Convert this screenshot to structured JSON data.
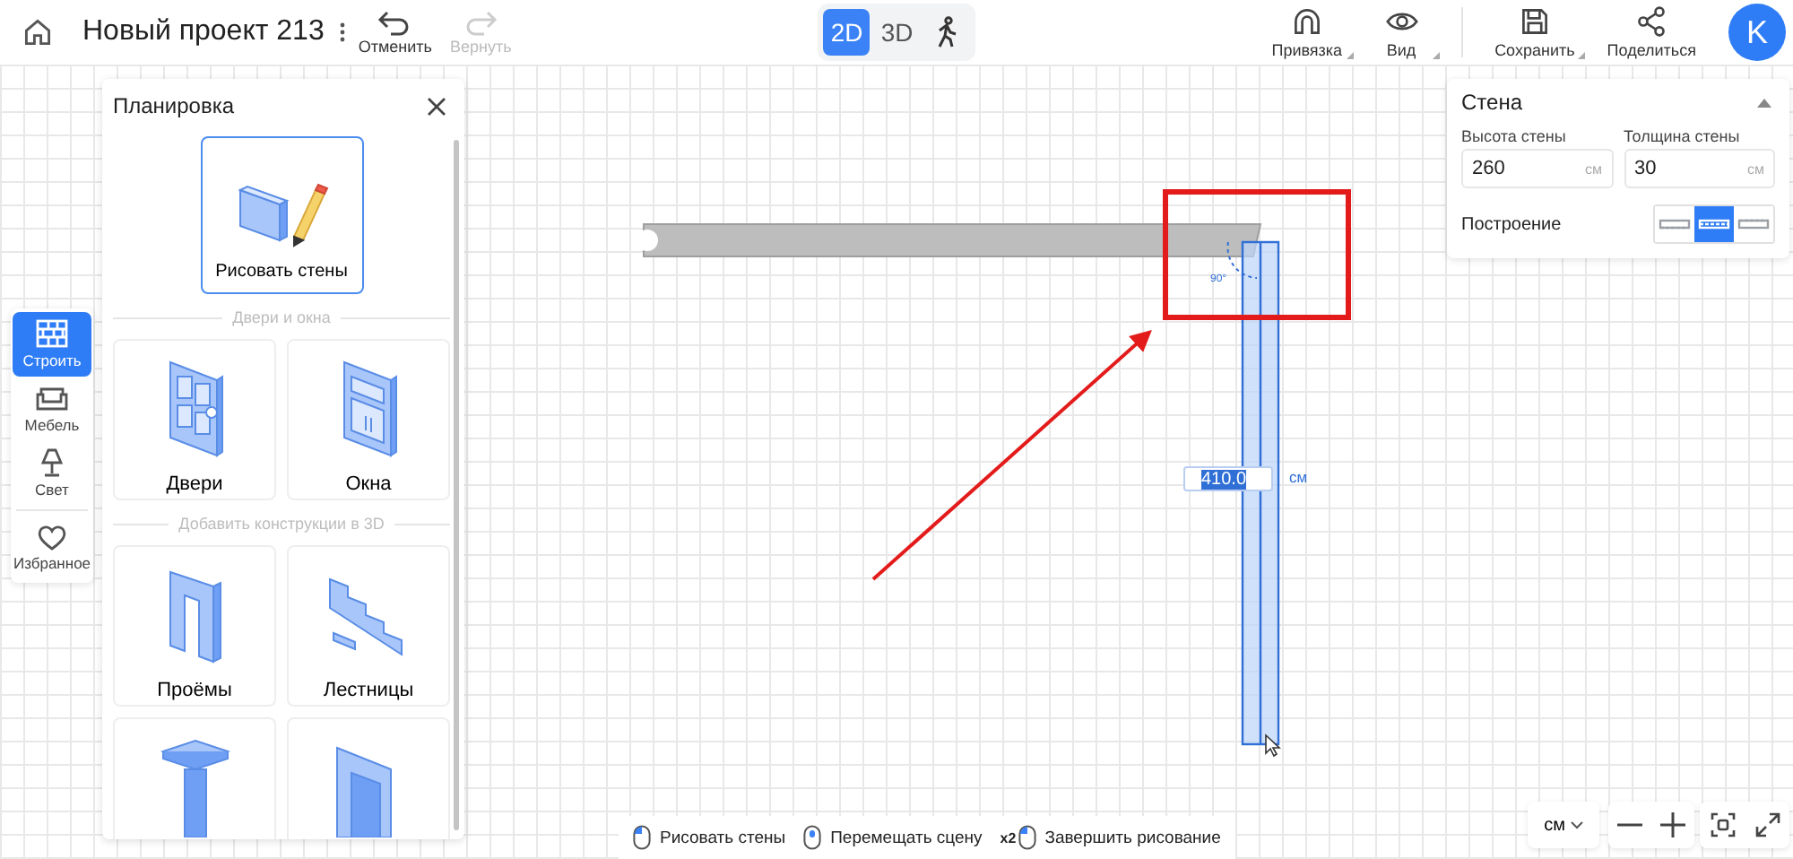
{
  "header": {
    "title": "Новый проект 213",
    "undo": {
      "label": "Отменить",
      "disabled": false
    },
    "redo": {
      "label": "Вернуть",
      "disabled": true
    },
    "view_modes": [
      {
        "kind": "text",
        "label": "2D",
        "selected": true
      },
      {
        "kind": "text",
        "label": "3D",
        "selected": false
      },
      {
        "kind": "walk",
        "selected": false
      }
    ],
    "tools": [
      {
        "kind": "magnet",
        "label": "Привязка",
        "menu": true
      },
      {
        "kind": "eye",
        "label": "Вид",
        "menu": true
      },
      {
        "kind": "save",
        "label": "Сохранить",
        "menu": true
      },
      {
        "kind": "share",
        "label": "Поделиться",
        "menu": false
      }
    ],
    "avatar": "K"
  },
  "rail": [
    {
      "kind": "build",
      "label": "Строить",
      "selected": true
    },
    {
      "kind": "sofa",
      "label": "Мебель",
      "selected": false
    },
    {
      "kind": "lamp",
      "label": "Свет",
      "selected": false
    },
    {
      "kind": "heart",
      "label": "Избранное",
      "selected": false
    }
  ],
  "panel": {
    "title": "Планировка",
    "featured": {
      "label": "Рисовать стены",
      "selected": true
    },
    "sections": [
      {
        "title": "Двери и окна",
        "items": [
          {
            "kind": "door",
            "label": "Двери"
          },
          {
            "kind": "window",
            "label": "Окна"
          }
        ]
      },
      {
        "title": "Добавить конструкции в 3D",
        "items": [
          {
            "kind": "opening",
            "label": "Проёмы"
          },
          {
            "kind": "stairs",
            "label": "Лестницы"
          },
          {
            "kind": "column"
          },
          {
            "kind": "niche"
          }
        ]
      }
    ]
  },
  "properties": {
    "title": "Стена",
    "expanded": true,
    "fields": [
      {
        "label": "Высота стены",
        "value": "260",
        "unit": "см"
      },
      {
        "label": "Толщина стены",
        "value": "30",
        "unit": "см"
      }
    ],
    "build_label": "Построение",
    "build_modes": [
      {
        "kind": "inner",
        "selected": false
      },
      {
        "kind": "center",
        "selected": true
      },
      {
        "kind": "outer",
        "selected": false
      }
    ]
  },
  "canvas": {
    "angle": "90°",
    "length": {
      "value": "410.0",
      "unit": "см",
      "selected": true
    }
  },
  "hints": [
    {
      "kind": "click",
      "label": "Рисовать стены"
    },
    {
      "kind": "wheel",
      "label": "Перемещать сцену"
    },
    {
      "prefix": "x2",
      "kind": "click",
      "label": "Завершить рисование"
    }
  ],
  "zoom_controls": {
    "unit": "см"
  }
}
